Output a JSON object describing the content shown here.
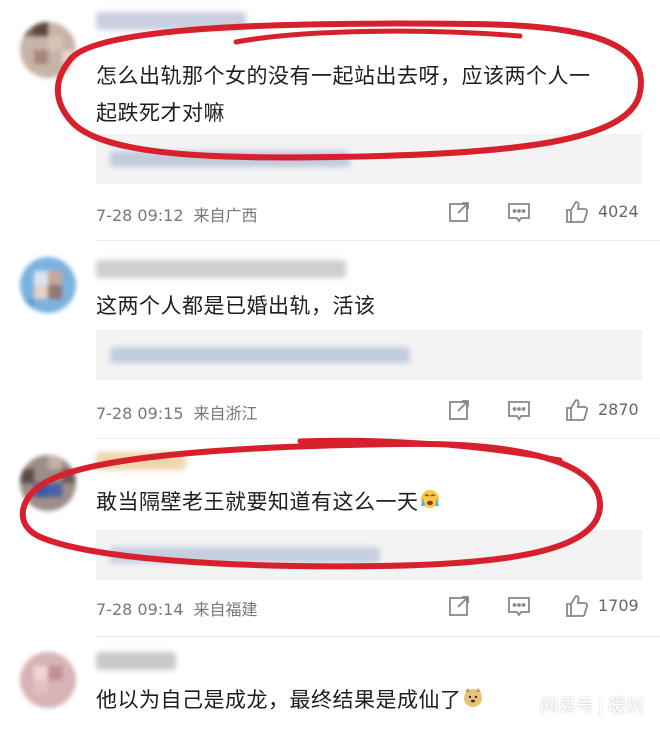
{
  "comments": [
    {
      "text_line1": "怎么出轨那个女的没有一起站出去呀，应该两个人一",
      "text_line2": "起跌死才对嘛",
      "time": "7-28 09:12",
      "location": "来自广西",
      "likes": "4024"
    },
    {
      "text_line1": "这两个人都是已婚出轨，活该",
      "time": "7-28 09:15",
      "location": "来自浙江",
      "likes": "2870"
    },
    {
      "text_line1": "敢当隔壁老王就要知道有这么一天",
      "emoji": "crying-face-icon",
      "time": "7-28 09:14",
      "location": "来自福建",
      "likes": "1709"
    },
    {
      "text_line1": "他以为自己是成龙，最终结果是成仙了",
      "emoji": "doge-face-icon"
    }
  ],
  "watermark": {
    "brand": "网易号",
    "separator": "|",
    "author": "暖树"
  },
  "colors": {
    "highlight_oval": "#d8202c",
    "meta_text": "#777777",
    "reply_box": "#f3f3f3"
  }
}
